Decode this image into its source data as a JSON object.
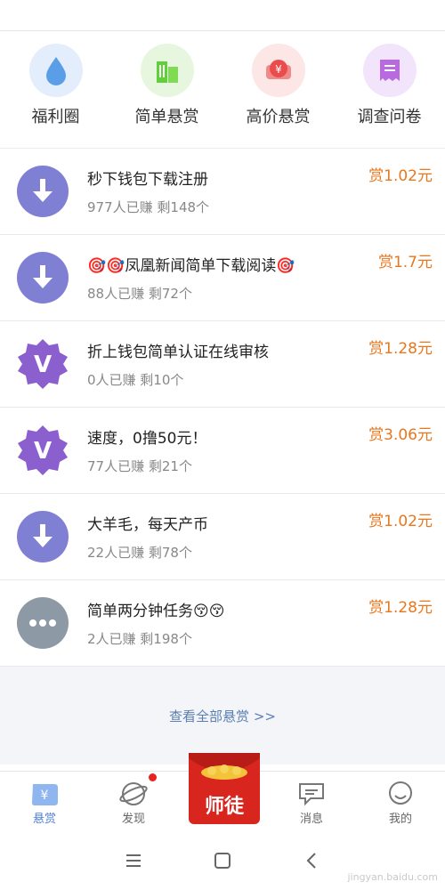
{
  "categories": [
    {
      "label": "福利圈",
      "icon": "water-drop-icon"
    },
    {
      "label": "简单悬赏",
      "icon": "building-icon"
    },
    {
      "label": "高价悬赏",
      "icon": "yuan-coin-icon"
    },
    {
      "label": "调查问卷",
      "icon": "receipt-icon"
    }
  ],
  "tasks": [
    {
      "title": "秒下钱包下载注册",
      "stats": "977人已赚  剩148个",
      "reward": "赏1.02元",
      "icon": "download-icon"
    },
    {
      "title": "🎯🎯凤凰新闻简单下载阅读🎯",
      "stats": "88人已赚  剩72个",
      "reward": "赏1.7元",
      "icon": "download-icon"
    },
    {
      "title": "折上钱包简单认证在线审核",
      "stats": "0人已赚  剩10个",
      "reward": "赏1.28元",
      "icon": "verified-v-icon"
    },
    {
      "title": "速度，0撸50元！",
      "stats": "77人已赚  剩21个",
      "reward": "赏3.06元",
      "icon": "verified-v-icon"
    },
    {
      "title": "大羊毛，每天产币",
      "stats": "22人已赚  剩78个",
      "reward": "赏1.02元",
      "icon": "download-icon"
    },
    {
      "title": "简单两分钟任务😚😚",
      "stats": "2人已赚  剩198个",
      "reward": "赏1.28元",
      "icon": "more-dots-icon"
    }
  ],
  "more_link": "查看全部悬赏 >>",
  "tabs": {
    "reward": "悬赏",
    "discover": "发现",
    "master": "师徒",
    "messages": "消息",
    "mine": "我的"
  },
  "watermark": "jingyan.baidu.com",
  "colors": {
    "accent": "#4b7fd6",
    "reward": "#e8771e",
    "icon_purple": "#7f7fd4",
    "badge_purple": "#8b5fce",
    "envelope_red": "#d8261f"
  }
}
